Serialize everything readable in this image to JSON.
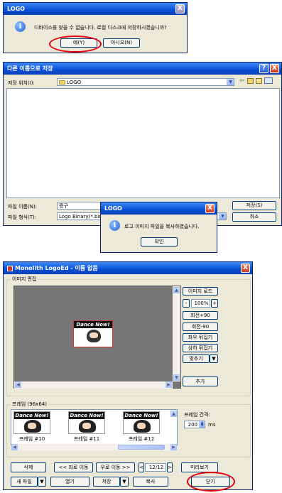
{
  "dialog1": {
    "title": "LOGO",
    "close_glyph": "X",
    "message": "디바이스를 찾을 수 없습니다. 로컬 디스크에 저장하시겠습니까?",
    "yes_label": "예(Y)",
    "no_label": "아니오(N)",
    "icon": "info-icon"
  },
  "save_dialog": {
    "title": "다른 이름으로 저장",
    "help_glyph": "?",
    "close_glyph": "X",
    "location_label": "저장 위치(I):",
    "location_value": "LOGO",
    "filename_label": "파일 이름(N):",
    "filename_value": "짱구",
    "filetype_label": "파일 형식(T):",
    "filetype_value": "Logo Binary(*.bin)",
    "save_label": "저장(S)",
    "cancel_label": "취소",
    "toolbar_icons": [
      "back-icon",
      "up-folder-icon",
      "new-folder-icon",
      "view-menu-icon"
    ]
  },
  "dialog2": {
    "title": "LOGO",
    "close_glyph": "X",
    "message": "로고 이미지 파일을 복사하였습니다.",
    "ok_label": "확인",
    "icon": "info-icon"
  },
  "logoed": {
    "title": "Monolith LogoEd - 이름 없음",
    "close_glyph": "X",
    "image_group_label": "이미지 편집",
    "image_text": "Dance Now!",
    "buttons": {
      "load_image": "이미지 로드",
      "zoom_minus": "-",
      "zoom_value": "100%",
      "zoom_plus": "+",
      "rotate_plus": "회전+90",
      "rotate_minus": "회전-90",
      "flip_h": "좌우 뒤집기",
      "flip_v": "상하 뒤집기",
      "fit": "맞추기",
      "add": "추가"
    },
    "frames_group_label": "프레임 (96x64)",
    "frames": [
      {
        "label": "프레임 #10",
        "image_text": "Dance Now!"
      },
      {
        "label": "프레임 #11",
        "image_text": "Dance Now!"
      },
      {
        "label": "프레임 #12",
        "image_text": "Dance Now!"
      }
    ],
    "frame_interval_label": "프레임 간격:",
    "frame_interval_value": "200",
    "frame_interval_unit": "ms",
    "delete_label": "삭제",
    "move_left_label": "<< 좌로 이동",
    "move_right_label": "우로 이동 >>",
    "page_value": "12/12",
    "preview_label": "미리보기",
    "new_file_label": "새 파일",
    "open_label": "열기",
    "save_label": "저장",
    "copy_label": "복사",
    "close_label": "닫기"
  }
}
